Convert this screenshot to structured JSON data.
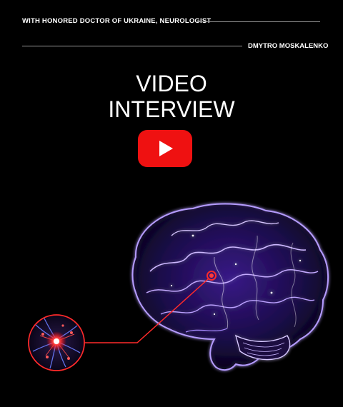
{
  "header": {
    "subtitle": "WITH HONORED DOCTOR OF UKRAINE, NEUROLOGIST",
    "author": "DMYTRO MOSKALENKO"
  },
  "hero": {
    "title_line1": "VIDEO",
    "title_line2": "INTERVIEW"
  },
  "play_button": {
    "icon": "youtube-play-icon",
    "color": "#ef1111"
  },
  "illustration": {
    "brain_icon": "glowing-brain-illustration",
    "neuron_icon": "neuron-closeup-illustration",
    "accent_color": "#ff2a2a",
    "glow_color": "#8b5cff"
  }
}
